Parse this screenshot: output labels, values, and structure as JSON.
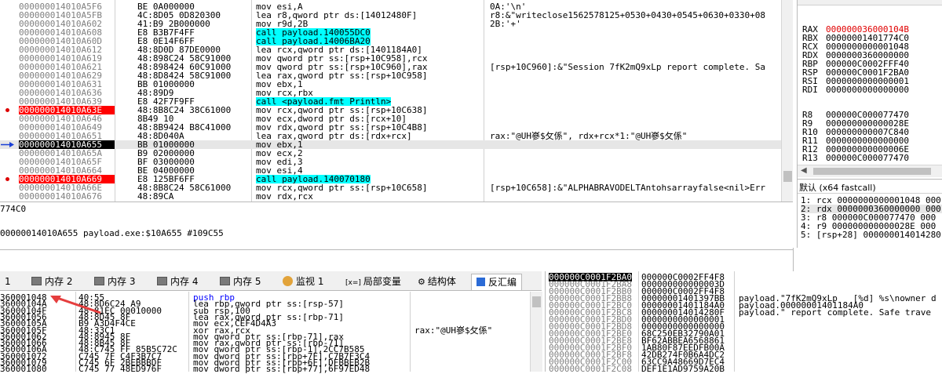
{
  "disasm": {
    "rows": [
      {
        "addr": "000000014010A5F6",
        "bytes": "BE 0A000000",
        "instr": "mov esi,A",
        "cmt": "0A:'\\n'",
        "bp": false
      },
      {
        "addr": "000000014010A5FB",
        "bytes": "4C:8D05 0D820300",
        "instr": "lea r8,qword ptr ds:[14012480F]",
        "cmt": "r8:&\"writeclose1562578125+0530+0430+0545+0630+0330+08",
        "bp": false
      },
      {
        "addr": "000000014010A602",
        "bytes": "41:B9 2B000000",
        "instr": "mov r9d,2B",
        "cmt": "2B:'+'",
        "bp": false
      },
      {
        "addr": "000000014010A608",
        "bytes": "E8 B3B7F4FF",
        "instr": "call payload.140055DC0",
        "cmt": "",
        "bp": false
      },
      {
        "addr": "000000014010A60D",
        "bytes": "E8 0E14F6FF",
        "instr": "call payload.14006BA20",
        "cmt": "",
        "bp": false
      },
      {
        "addr": "000000014010A612",
        "bytes": "48:8D0D 87DE0000",
        "instr": "lea rcx,qword ptr ds:[1401184A0]",
        "cmt": "",
        "bp": false
      },
      {
        "addr": "000000014010A619",
        "bytes": "48:898C24 58C91000",
        "instr": "mov qword ptr ss:[rsp+10C958],rcx",
        "cmt": "",
        "bp": false
      },
      {
        "addr": "000000014010A621",
        "bytes": "48:898424 60C91000",
        "instr": "mov qword ptr ss:[rsp+10C960],rax",
        "cmt": "[rsp+10C960]:&\"Session 7fK2mQ9xLp report complete. Sa",
        "bp": false
      },
      {
        "addr": "000000014010A629",
        "bytes": "48:8D8424 58C91000",
        "instr": "lea rax,qword ptr ss:[rsp+10C958]",
        "cmt": "",
        "bp": false
      },
      {
        "addr": "000000014010A631",
        "bytes": "BB 01000000",
        "instr": "mov ebx,1",
        "cmt": "",
        "bp": false
      },
      {
        "addr": "000000014010A636",
        "bytes": "48:89D9",
        "instr": "mov rcx,rbx",
        "cmt": "",
        "bp": false
      },
      {
        "addr": "000000014010A639",
        "bytes": "E8 42F7F9FF",
        "instr": "call <payload.fmt_Println>",
        "cmt": "",
        "bp": false
      },
      {
        "addr": "000000014010A63E",
        "bytes": "48:8B8C24 38C61000",
        "instr": "mov rcx,qword ptr ss:[rsp+10C638]",
        "cmt": "",
        "bp": true
      },
      {
        "addr": "000000014010A646",
        "bytes": "8B49 10",
        "instr": "mov ecx,dword ptr ds:[rcx+10]",
        "cmt": "",
        "bp": false
      },
      {
        "addr": "000000014010A649",
        "bytes": "48:8B9424 B8C41000",
        "instr": "mov rdx,qword ptr ss:[rsp+10C4B8]",
        "cmt": "",
        "bp": false
      },
      {
        "addr": "000000014010A651",
        "bytes": "48:8D040A",
        "instr": "lea rax,qword ptr ds:[rdx+rcx]",
        "cmt": "rax:\"@UH嵾$攵係\", rdx+rcx*1:\"@UH嵾$攵係\"",
        "bp": false
      },
      {
        "addr": "000000014010A655",
        "bytes": "BB 01000000",
        "instr": "mov ebx,1",
        "cmt": "",
        "bp": false
      },
      {
        "addr": "000000014010A65A",
        "bytes": "B9 02000000",
        "instr": "mov ecx,2",
        "cmt": "",
        "bp": false
      },
      {
        "addr": "000000014010A65F",
        "bytes": "BF 03000000",
        "instr": "mov edi,3",
        "cmt": "",
        "bp": false
      },
      {
        "addr": "000000014010A664",
        "bytes": "BE 04000000",
        "instr": "mov esi,4",
        "cmt": "",
        "bp": false
      },
      {
        "addr": "000000014010A669",
        "bytes": "E8 125BF6FF",
        "instr": "call payload.140070180",
        "cmt": "",
        "bp": true
      },
      {
        "addr": "000000014010A66E",
        "bytes": "48:8B8C24 58C61000",
        "instr": "mov rcx,qword ptr ss:[rsp+10C658]",
        "cmt": "[rsp+10C658]:&\"ALPHABRAVODELTAntohsarrayfalse<nil>Err",
        "bp": false
      },
      {
        "addr": "000000014010A676",
        "bytes": "48:89CA",
        "instr": "mov rdx,rcx",
        "cmt": "",
        "bp": false
      }
    ]
  },
  "registers": {
    "rows": [
      {
        "name": "RAX",
        "value": "000000036000104B",
        "red": true
      },
      {
        "name": "RBX",
        "value": "00000001401774C0",
        "red": false
      },
      {
        "name": "RCX",
        "value": "0000000000001048",
        "red": false
      },
      {
        "name": "RDX",
        "value": "0000000360000000",
        "red": false
      },
      {
        "name": "RBP",
        "value": "000000C0002FFF40",
        "red": false
      },
      {
        "name": "RSP",
        "value": "000000C0001F2BA0",
        "red": false
      },
      {
        "name": "RSI",
        "value": "0000000000000001",
        "red": false
      },
      {
        "name": "RDI",
        "value": "0000000000000000",
        "red": false
      },
      {
        "name": "R8",
        "value": "000000C000077470",
        "red": false
      },
      {
        "name": "R9",
        "value": "000000000000028E",
        "red": false
      },
      {
        "name": "R10",
        "value": "000000000007C840",
        "red": false
      },
      {
        "name": "R11",
        "value": "0000000000000000",
        "red": false
      },
      {
        "name": "R12",
        "value": "000000000000006E",
        "red": false
      },
      {
        "name": "R13",
        "value": "000000C000077470",
        "red": false
      }
    ]
  },
  "callconv": {
    "label": "默认 (x64 fastcall)",
    "args": [
      "1: rcx 0000000000001048 000",
      "2: rdx 0000000360000000 000",
      "3: r8 000000C000077470 000",
      "4: r9 000000000000028E 000",
      "5: [rsp+28] 000000014014280"
    ]
  },
  "info": {
    "line1": "774C0",
    "line2": "00000014010A655 payload.exe:$10A655 #109C55"
  },
  "tabs": [
    {
      "label": "1",
      "active": false
    },
    {
      "label": "内存 2",
      "active": false
    },
    {
      "label": "内存 3",
      "active": false
    },
    {
      "label": "内存 4",
      "active": false
    },
    {
      "label": "内存 5",
      "active": false
    },
    {
      "label": "监视 1",
      "active": false
    },
    {
      "label": "局部变量",
      "active": false
    },
    {
      "label": "结构体",
      "active": false
    },
    {
      "label": "反汇编",
      "active": true
    }
  ],
  "dump": {
    "rows": [
      {
        "addr": "360001048",
        "bytes": "40:55",
        "instr": "push rbp",
        "cmt": ""
      },
      {
        "addr": "36000104A",
        "bytes": "48:8D6C24 A9",
        "instr": "lea rbp,qword ptr ss:[rsp-57]",
        "cmt": ""
      },
      {
        "addr": "36000104F",
        "bytes": "48:81EC 00010000",
        "instr": "sub rsp,100",
        "cmt": ""
      },
      {
        "addr": "360001056",
        "bytes": "48:8D45 8F",
        "instr": "lea rax,qword ptr ss:[rbp-71]",
        "cmt": ""
      },
      {
        "addr": "36000105A",
        "bytes": "B9 A3D4F4CE",
        "instr": "mov ecx,CEF4D4A3",
        "cmt": ""
      },
      {
        "addr": "36000105F",
        "bytes": "48:33C1",
        "instr": "xor rax,rcx",
        "cmt": "rax:\"@UH嵾$攵係\""
      },
      {
        "addr": "360001062",
        "bytes": "48:8945 8F",
        "instr": "mov qword ptr ss:[rbp-71],rax",
        "cmt": ""
      },
      {
        "addr": "360001066",
        "bytes": "48:8B45 8F",
        "instr": "mov rax,qword ptr ss:[rbp-71]",
        "cmt": ""
      },
      {
        "addr": "36000106A",
        "bytes": "48:C745 FF 85B5C72C",
        "instr": "mov qword ptr ss:[rbp-1],2CC7B585",
        "cmt": ""
      },
      {
        "addr": "360001072",
        "bytes": "C745 7F C4F3B7C7",
        "instr": "mov dword ptr ss:[rbp+7F],C7B7F3C4",
        "cmt": ""
      },
      {
        "addr": "360001079",
        "bytes": "C745 6F 2BEBBBDF",
        "instr": "mov dword ptr ss:[rbp+6F],DFBBEB2B",
        "cmt": ""
      },
      {
        "addr": "360001080",
        "bytes": "C745 77 48ED976F",
        "instr": "mov dword ptr ss:[rbp+77],6F97ED48",
        "cmt": ""
      }
    ]
  },
  "stack": {
    "rows": [
      {
        "addr": "000000C0001F2BA0",
        "val": "000000C0002FF4F8",
        "cmt": "",
        "sel": true
      },
      {
        "addr": "000000C0001F2BA8",
        "val": "000000000000003D",
        "cmt": "",
        "sel": false
      },
      {
        "addr": "000000C0001F2BB0",
        "val": "000000C0002FF4F8",
        "cmt": "",
        "sel": false
      },
      {
        "addr": "000000C0001F2BB8",
        "val": "00000001401397BB",
        "cmt": "payload.\"7fK2mQ9xLp   [%d] %s\\nowner d",
        "sel": false
      },
      {
        "addr": "000000C0001F2BC0",
        "val": "00000001401184A0",
        "cmt": "payload.00000001401184A0",
        "sel": false
      },
      {
        "addr": "000000C0001F2BC8",
        "val": "000000014014280F",
        "cmt": "payload.\" report complete. Safe trave",
        "sel": false
      },
      {
        "addr": "000000C0001F2BD0",
        "val": "0000000000000001",
        "cmt": "",
        "sel": false
      },
      {
        "addr": "000000C0001F2BD8",
        "val": "0000000000000000",
        "cmt": "",
        "sel": false
      },
      {
        "addr": "000000C0001F2BE0",
        "val": "68C250EB32790A01",
        "cmt": "",
        "sel": false
      },
      {
        "addr": "000000C0001F2BE8",
        "val": "BF62ABBEA6568861",
        "cmt": "",
        "sel": false
      },
      {
        "addr": "000000C0001F2BF0",
        "val": "1AB80F87EEDFB00A",
        "cmt": "",
        "sel": false
      },
      {
        "addr": "000000C0001F2BF8",
        "val": "42DB274F0B6A4DC2",
        "cmt": "",
        "sel": false
      },
      {
        "addr": "000000C0001F2C00",
        "val": "63CC9A48669D7EC4",
        "cmt": "",
        "sel": false
      },
      {
        "addr": "000000C0001F2C08",
        "val": "DEF1E1AD9759A20B",
        "cmt": "",
        "sel": false
      }
    ]
  },
  "colors": {
    "breakpoint": "#ff0000",
    "rip": "#000000",
    "call_highlight": "#00ffff",
    "addr_highlight": "#ffff00",
    "rbp": "#00a000",
    "arrow": "#e53e3e"
  }
}
